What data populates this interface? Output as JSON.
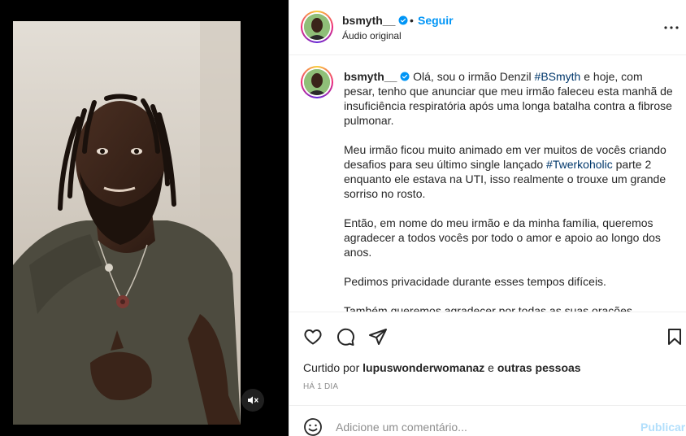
{
  "post": {
    "username": "bsmyth__",
    "follow_label": "Seguir",
    "separator": "•",
    "audio": "Áudio original"
  },
  "caption": {
    "username": "bsmyth__",
    "p1_a": "Olá, sou o irmão Denzil ",
    "p1_tag": "#BSmyth",
    "p1_b": " e hoje, com pesar, tenho que anunciar que meu irmão faleceu esta manhã de insuficiência respiratória após uma longa batalha contra a fibrose pulmonar.",
    "p2_a": "Meu irmão ficou muito animado em ver muitos de vocês criando desafios para seu último single lançado ",
    "p2_tag": "#Twerkoholic",
    "p2_b": " parte 2 enquanto ele estava na UTI, isso realmente o trouxe um grande sorriso no rosto.",
    "p3": "Então, em nome do meu irmão e da minha família, queremos agradecer a todos vocês por todo o amor e apoio ao longo dos anos.",
    "p4": "Pedimos privacidade durante esses tempos difíceis.",
    "p5": "Também queremos agradecer por todas as suas orações."
  },
  "likes": {
    "prefix": "Curtido por ",
    "user": "lupuswonderwomanaz",
    "middle": " e ",
    "suffix": "outras pessoas"
  },
  "timestamp": "HÁ 1 DIA",
  "comment": {
    "placeholder": "Adicione um comentário...",
    "post_label": "Publicar"
  },
  "icons": {
    "mute": "speaker-muted-icon",
    "more": "more-horizontal-icon",
    "like": "heart-icon",
    "comment": "comment-icon",
    "share": "paper-plane-icon",
    "save": "bookmark-icon",
    "emoji": "emoji-smile-icon",
    "verified": "verified-badge-icon"
  },
  "colors": {
    "accent": "#0095f6",
    "hashtag": "#00376b",
    "muted_text": "#8e8e8e",
    "post_disabled": "#b2dffc"
  }
}
